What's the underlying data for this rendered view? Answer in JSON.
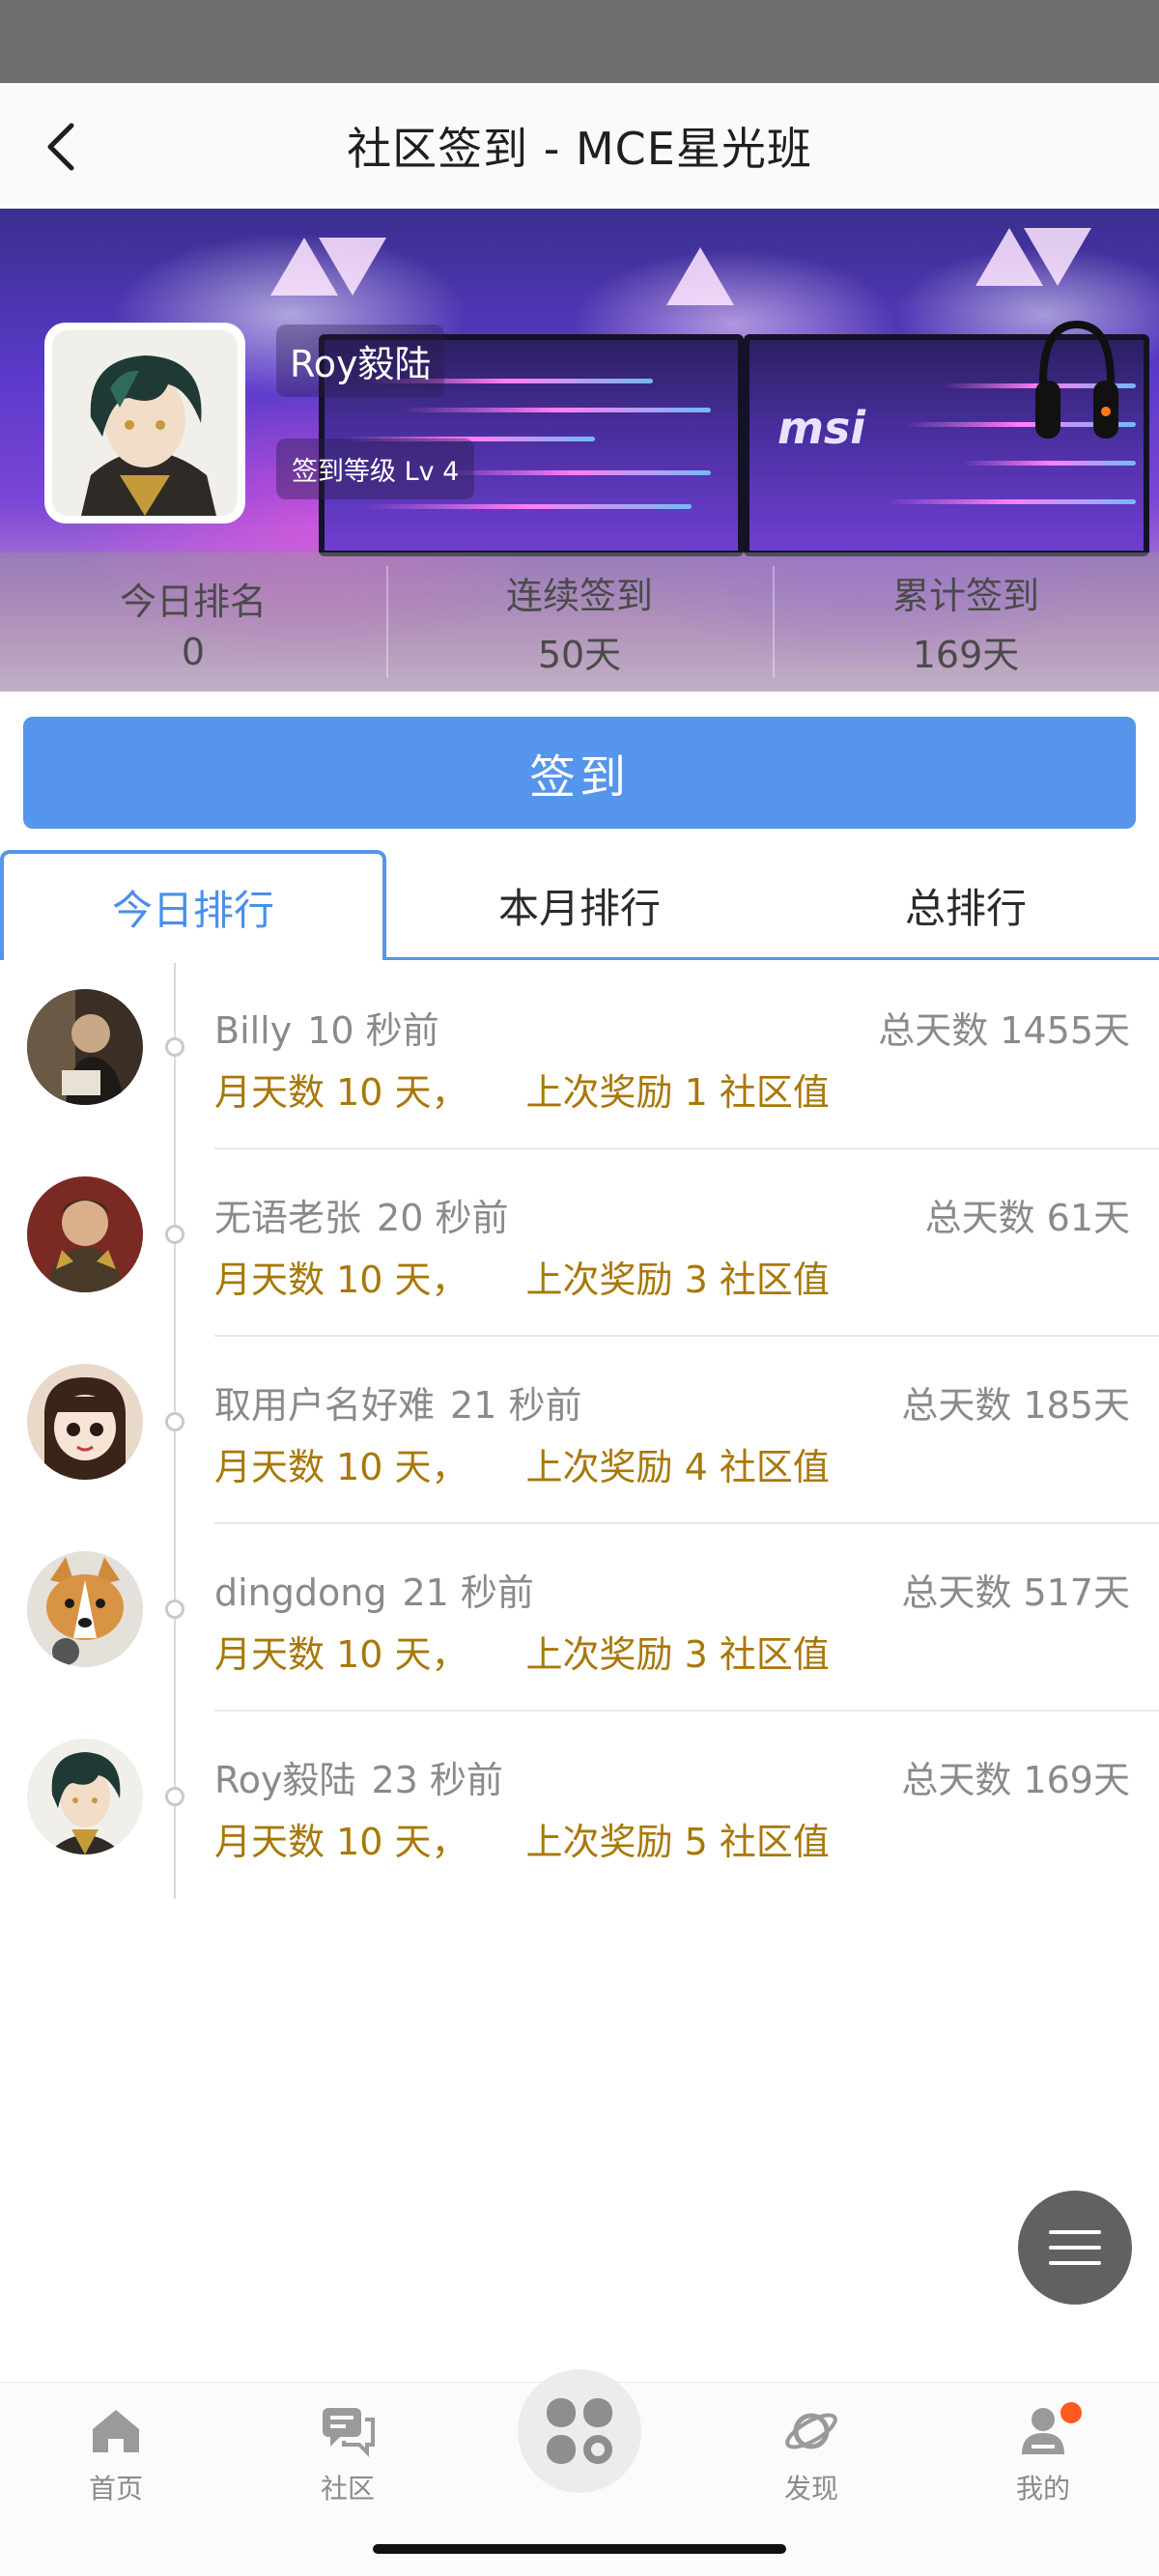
{
  "header": {
    "title": "社区签到 - MCE星光班"
  },
  "banner": {
    "brand_logo": "msi",
    "user_name": "Roy毅陆",
    "level_label": "签到等级 Lv 4"
  },
  "stats": [
    {
      "label": "今日排名",
      "value": "0"
    },
    {
      "label": "连续签到",
      "value": "50天"
    },
    {
      "label": "累计签到",
      "value": "169天"
    }
  ],
  "checkin": {
    "label": "签到"
  },
  "tabs": [
    {
      "label": "今日排行",
      "active": true
    },
    {
      "label": "本月排行",
      "active": false
    },
    {
      "label": "总排行",
      "active": false
    }
  ],
  "list": [
    {
      "name": "Billy",
      "time": "10 秒前",
      "total": "总天数 1455天",
      "month_days": "月天数 10 天，",
      "reward": "上次奖励 1 社区值",
      "avatar_icon": "avatar-photo-man"
    },
    {
      "name": "无语老张",
      "time": "20 秒前",
      "total": "总天数 61天",
      "month_days": "月天数 10 天，",
      "reward": "上次奖励 3 社区值",
      "avatar_icon": "avatar-warrior"
    },
    {
      "name": "取用户名好难",
      "time": "21 秒前",
      "total": "总天数 185天",
      "month_days": "月天数 10 天，",
      "reward": "上次奖励 4 社区值",
      "avatar_icon": "avatar-anime-girl"
    },
    {
      "name": "dingdong",
      "time": "21 秒前",
      "total": "总天数 517天",
      "month_days": "月天数 10 天，",
      "reward": "上次奖励 3 社区值",
      "avatar_icon": "avatar-corgi"
    },
    {
      "name": "Roy毅陆",
      "time": "23 秒前",
      "total": "总天数 169天",
      "month_days": "月天数 10 天，",
      "reward": "上次奖励 5 社区值",
      "avatar_icon": "avatar-anime-boy"
    }
  ],
  "tabbar": [
    {
      "label": "首页",
      "icon": "home-icon"
    },
    {
      "label": "社区",
      "icon": "community-chat-icon"
    },
    {
      "label": "",
      "icon": "apps-grid-icon"
    },
    {
      "label": "发现",
      "icon": "planet-icon"
    },
    {
      "label": "我的",
      "icon": "user-icon"
    }
  ],
  "colors": {
    "accent": "#5595ec",
    "reward_text": "#a87807",
    "muted_text": "#8a8a8a",
    "badge": "#ff5a1f"
  }
}
